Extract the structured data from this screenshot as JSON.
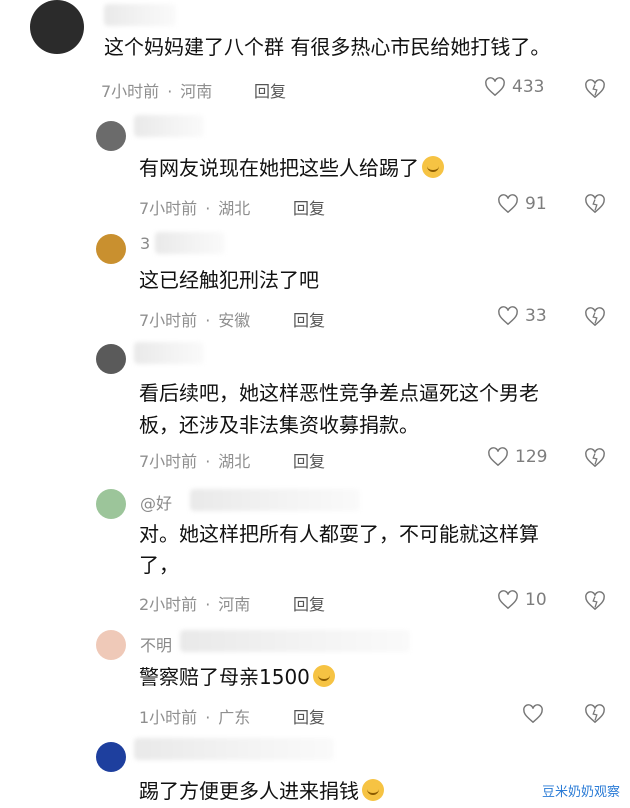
{
  "comments": [
    {
      "username": "",
      "text": "这个妈妈建了八个群 有很多热心市民给她打钱了。",
      "time": "7小时前",
      "location": "河南",
      "reply_label": "回复",
      "likes": "433"
    },
    {
      "username": "",
      "text": "有网友说现在她把这些人给踢了",
      "emoji": "cry-face",
      "time": "7小时前",
      "location": "湖北",
      "reply_label": "回复",
      "likes": "91"
    },
    {
      "username": "3",
      "text": "这已经触犯刑法了吧",
      "time": "7小时前",
      "location": "安徽",
      "reply_label": "回复",
      "likes": "33"
    },
    {
      "username": "",
      "text_line1": "看后续吧，她这样恶性竞争差点逼死这个男老",
      "text_line2": "板，还涉及非法集资收募捐款。",
      "time": "7小时前",
      "location": "湖北",
      "reply_label": "回复",
      "likes": "129"
    },
    {
      "username": "@好",
      "text_line1": "对。她这样把所有人都耍了，不可能就这样算",
      "text_line2": "了，",
      "time": "2小时前",
      "location": "河南",
      "reply_label": "回复",
      "likes": "10"
    },
    {
      "username": "不明",
      "text": "警察赔了母亲1500",
      "emoji": "pleading-face",
      "time": "1小时前",
      "location": "广东",
      "reply_label": "回复",
      "likes": ""
    },
    {
      "username": "",
      "text": "踢了方便更多人进来捐钱",
      "emoji": "laughing-tears-face"
    }
  ],
  "watermark": "豆米奶奶观察",
  "colors": {
    "meta": "#8f8f8f",
    "text": "#111111",
    "watermark": "#2a7bd6"
  }
}
